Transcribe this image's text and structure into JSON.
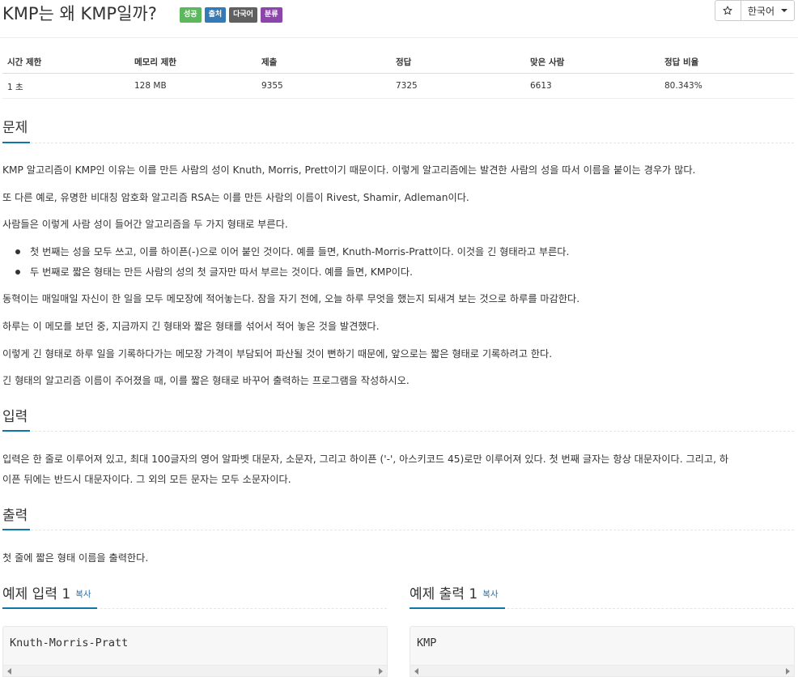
{
  "problem": {
    "title": "KMP는 왜 KMP일까?",
    "badges": [
      {
        "label": "성공",
        "color": "#5cb85c"
      },
      {
        "label": "출처",
        "color": "#337ab7"
      },
      {
        "label": "다국어",
        "color": "#606060"
      },
      {
        "label": "분류",
        "color": "#8e44ad"
      }
    ]
  },
  "controls": {
    "language": "한국어"
  },
  "stats": {
    "headers": [
      "시간 제한",
      "메모리 제한",
      "제출",
      "정답",
      "맞은 사람",
      "정답 비율"
    ],
    "values": [
      "1 초",
      "128 MB",
      "9355",
      "7325",
      "6613",
      "80.343%"
    ]
  },
  "sections": {
    "problem_heading": "문제",
    "input_heading": "입력",
    "output_heading": "출력"
  },
  "description": {
    "p1": "KMP 알고리즘이 KMP인 이유는 이를 만든 사람의 성이 Knuth, Morris, Prett이기 때문이다. 이렇게 알고리즘에는 발견한 사람의 성을 따서 이름을 붙이는 경우가 많다.",
    "p2": "또 다른 예로, 유명한 비대칭 암호화 알고리즘 RSA는 이를 만든 사람의 이름이 Rivest, Shamir, Adleman이다.",
    "p3": "사람들은 이렇게 사람 성이 들어간 알고리즘을 두 가지 형태로 부른다.",
    "li1": "첫 번째는 성을 모두 쓰고, 이를 하이픈(-)으로 이어 붙인 것이다. 예를 들면, Knuth-Morris-Pratt이다. 이것을 긴 형태라고 부른다.",
    "li2": "두 번째로 짧은 형태는 만든 사람의 성의 첫 글자만 따서 부르는 것이다. 예를 들면, KMP이다.",
    "p4": "동혁이는 매일매일 자신이 한 일을 모두 메모장에 적어놓는다. 잠을 자기 전에, 오늘 하루 무엇을 했는지 되새겨 보는 것으로 하루를 마감한다.",
    "p5": "하루는 이 메모를 보던 중, 지금까지 긴 형태와 짧은 형태를 섞어서 적어 놓은 것을 발견했다.",
    "p6": "이렇게 긴 형태로 하루 일을 기록하다가는 메모장 가격이 부담되어 파산될 것이 뻔하기 때문에, 앞으로는 짧은 형태로 기록하려고 한다.",
    "p7": "긴 형태의 알고리즘 이름이 주어졌을 때, 이를 짧은 형태로 바꾸어 출력하는 프로그램을 작성하시오."
  },
  "input": {
    "line1": "입력은 한 줄로 이루어져 있고, 최대 100글자의 영어 알파벳 대문자, 소문자, 그리고 하이픈 ('-', 아스키코드 45)로만 이루어져 있다. 첫 번째 글자는 항상 대문자이다. 그리고, 하",
    "line2": "이픈 뒤에는 반드시 대문자이다. 그 외의 모든 문자는 모두 소문자이다."
  },
  "output": {
    "text": "첫 줄에 짧은 형태 이름을 출력한다."
  },
  "samples": {
    "input_heading": "예제 입력 1",
    "output_heading": "예제 출력 1",
    "copy_label": "복사",
    "input_value": "Knuth-Morris-Pratt",
    "output_value": "KMP"
  }
}
